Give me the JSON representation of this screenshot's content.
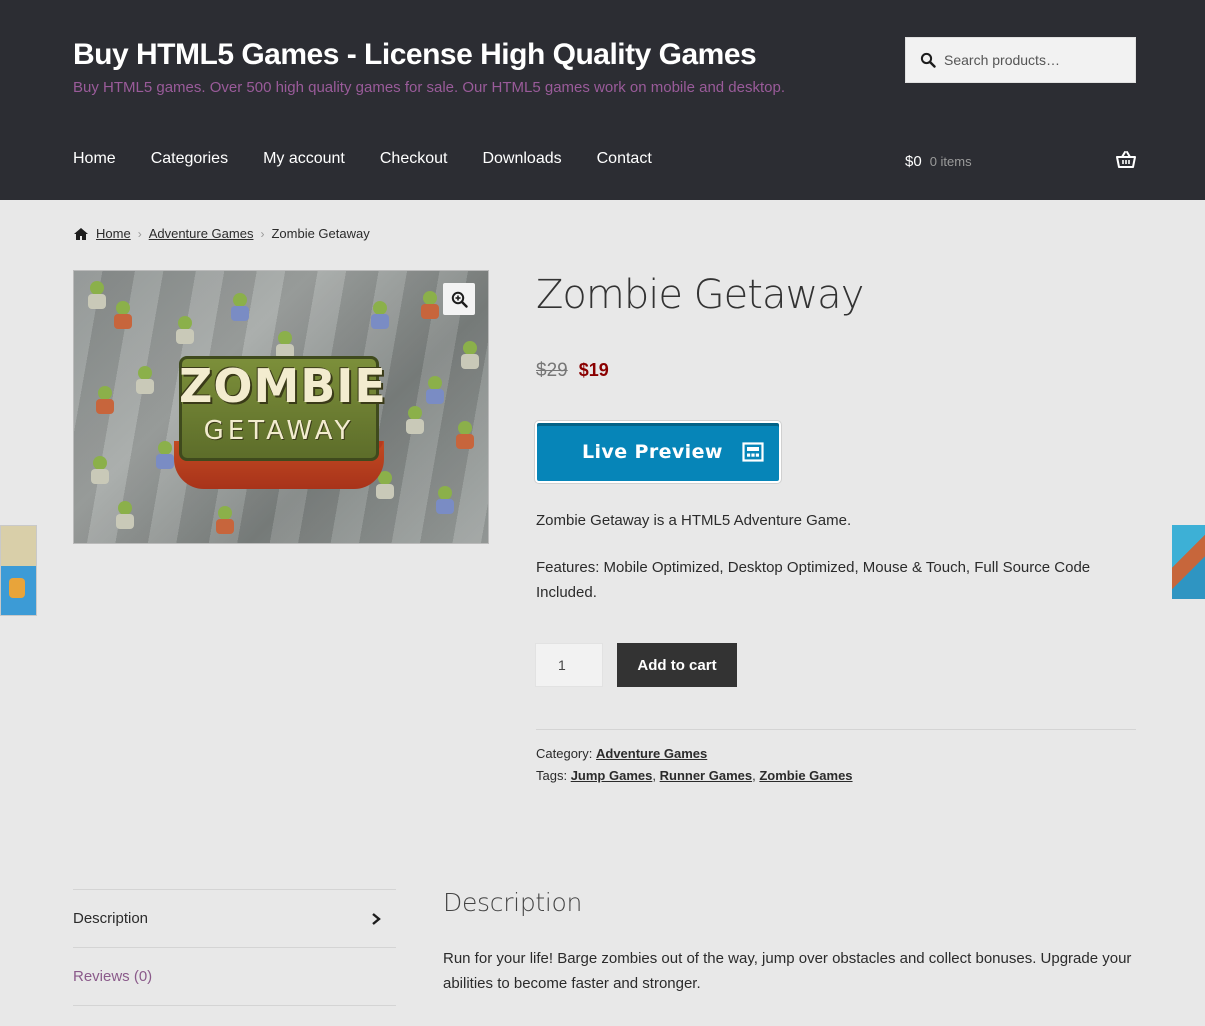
{
  "site": {
    "title": "Buy HTML5 Games - License High Quality Games",
    "description": "Buy HTML5 games. Over 500 high quality games for sale. Our HTML5 games work on mobile and desktop."
  },
  "search": {
    "placeholder": "Search products…"
  },
  "nav": {
    "items": [
      {
        "label": "Home"
      },
      {
        "label": "Categories"
      },
      {
        "label": "My account"
      },
      {
        "label": "Checkout"
      },
      {
        "label": "Downloads"
      },
      {
        "label": "Contact"
      }
    ]
  },
  "cart": {
    "amount": "$0",
    "count": "0 items"
  },
  "breadcrumb": {
    "home": "Home",
    "category": "Adventure Games",
    "current": "Zombie Getaway",
    "separator": "›"
  },
  "product": {
    "image_logo_top": "ZOMBIE",
    "image_logo_bottom": "GETAWAY",
    "title": "Zombie Getaway",
    "price_old": "$29",
    "price_new": "$19",
    "preview_label": "Live Preview",
    "short_description": "Zombie Getaway is a HTML5 Adventure Game.",
    "features": "Features: Mobile Optimized, Desktop Optimized, Mouse & Touch, Full Source Code Included.",
    "quantity": "1",
    "add_to_cart_label": "Add to cart",
    "category_label": "Category:",
    "category": "Adventure Games",
    "tags_label": "Tags:",
    "tags": [
      "Jump Games",
      "Runner Games",
      "Zombie Games"
    ],
    "tag_separator": ","
  },
  "tabs": {
    "description": "Description",
    "reviews": "Reviews (0)"
  },
  "panel": {
    "title": "Description",
    "text": "Run for your life! Barge zombies out of the way, jump over obstacles and collect bonuses. Upgrade your abilities to become faster and stronger."
  },
  "icons": {
    "search": "search-icon",
    "cart": "basket-icon",
    "home": "home-icon",
    "zoom": "zoom-in-icon",
    "preview": "window-icon",
    "tab_arrow": "chevron-right-icon"
  },
  "colors": {
    "header_bg": "#2c2d33",
    "tagline": "#9a5b9a",
    "preview_button": "#0685b8",
    "sale_price": "#8a0000",
    "add_to_cart": "#333333"
  }
}
